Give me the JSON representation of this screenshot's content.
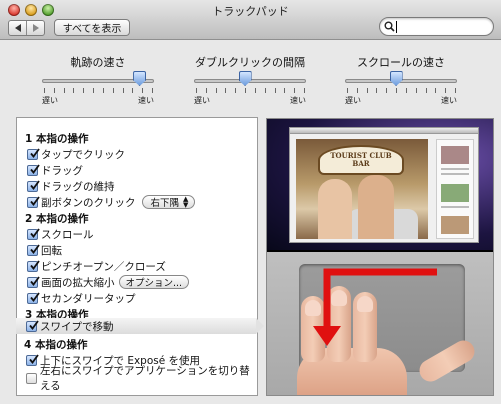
{
  "window": {
    "title": "トラックパッド"
  },
  "toolbar": {
    "show_all": "すべてを表示",
    "search_value": ""
  },
  "sliders": [
    {
      "title": "軌跡の速さ",
      "min_label": "遅い",
      "max_label": "速い",
      "value": 0.92
    },
    {
      "title": "ダブルクリックの間隔",
      "min_label": "遅い",
      "max_label": "速い",
      "value": 0.45
    },
    {
      "title": "スクロールの速さ",
      "min_label": "遅い",
      "max_label": "速い",
      "value": 0.45
    }
  ],
  "options": {
    "one_finger": {
      "title": "1 本指の操作",
      "tap_to_click": {
        "label": "タップでクリック",
        "checked": true
      },
      "dragging": {
        "label": "ドラッグ",
        "checked": true
      },
      "drag_lock": {
        "label": "ドラッグの維持",
        "checked": true
      },
      "secondary_click": {
        "label": "副ボタンのクリック",
        "checked": true,
        "popup_value": "右下隅"
      }
    },
    "two_finger": {
      "title": "2 本指の操作",
      "scroll": {
        "label": "スクロール",
        "checked": true
      },
      "rotate": {
        "label": "回転",
        "checked": true
      },
      "pinch": {
        "label": "ピンチオープン／クローズ",
        "checked": true
      },
      "zoom": {
        "label": "画面の拡大縮小",
        "checked": true,
        "button_label": "オプション..."
      },
      "secondary_tap": {
        "label": "セカンダリータップ",
        "checked": true
      }
    },
    "three_finger": {
      "title": "3 本指の操作",
      "swipe_navigate": {
        "label": "スワイプで移動",
        "checked": true
      }
    },
    "four_finger": {
      "title": "4 本指の操作",
      "swipe_expose": {
        "label": "上下にスワイプで Exposé を使用",
        "checked": true
      },
      "swipe_app_switch": {
        "label": "左右にスワイプでアプリケーションを切り替える",
        "checked": false
      }
    }
  },
  "preview": {
    "sign_line1": "TOURIST CLUB",
    "sign_line2": "BAR",
    "gesture_arrow_color": "#e01010"
  }
}
